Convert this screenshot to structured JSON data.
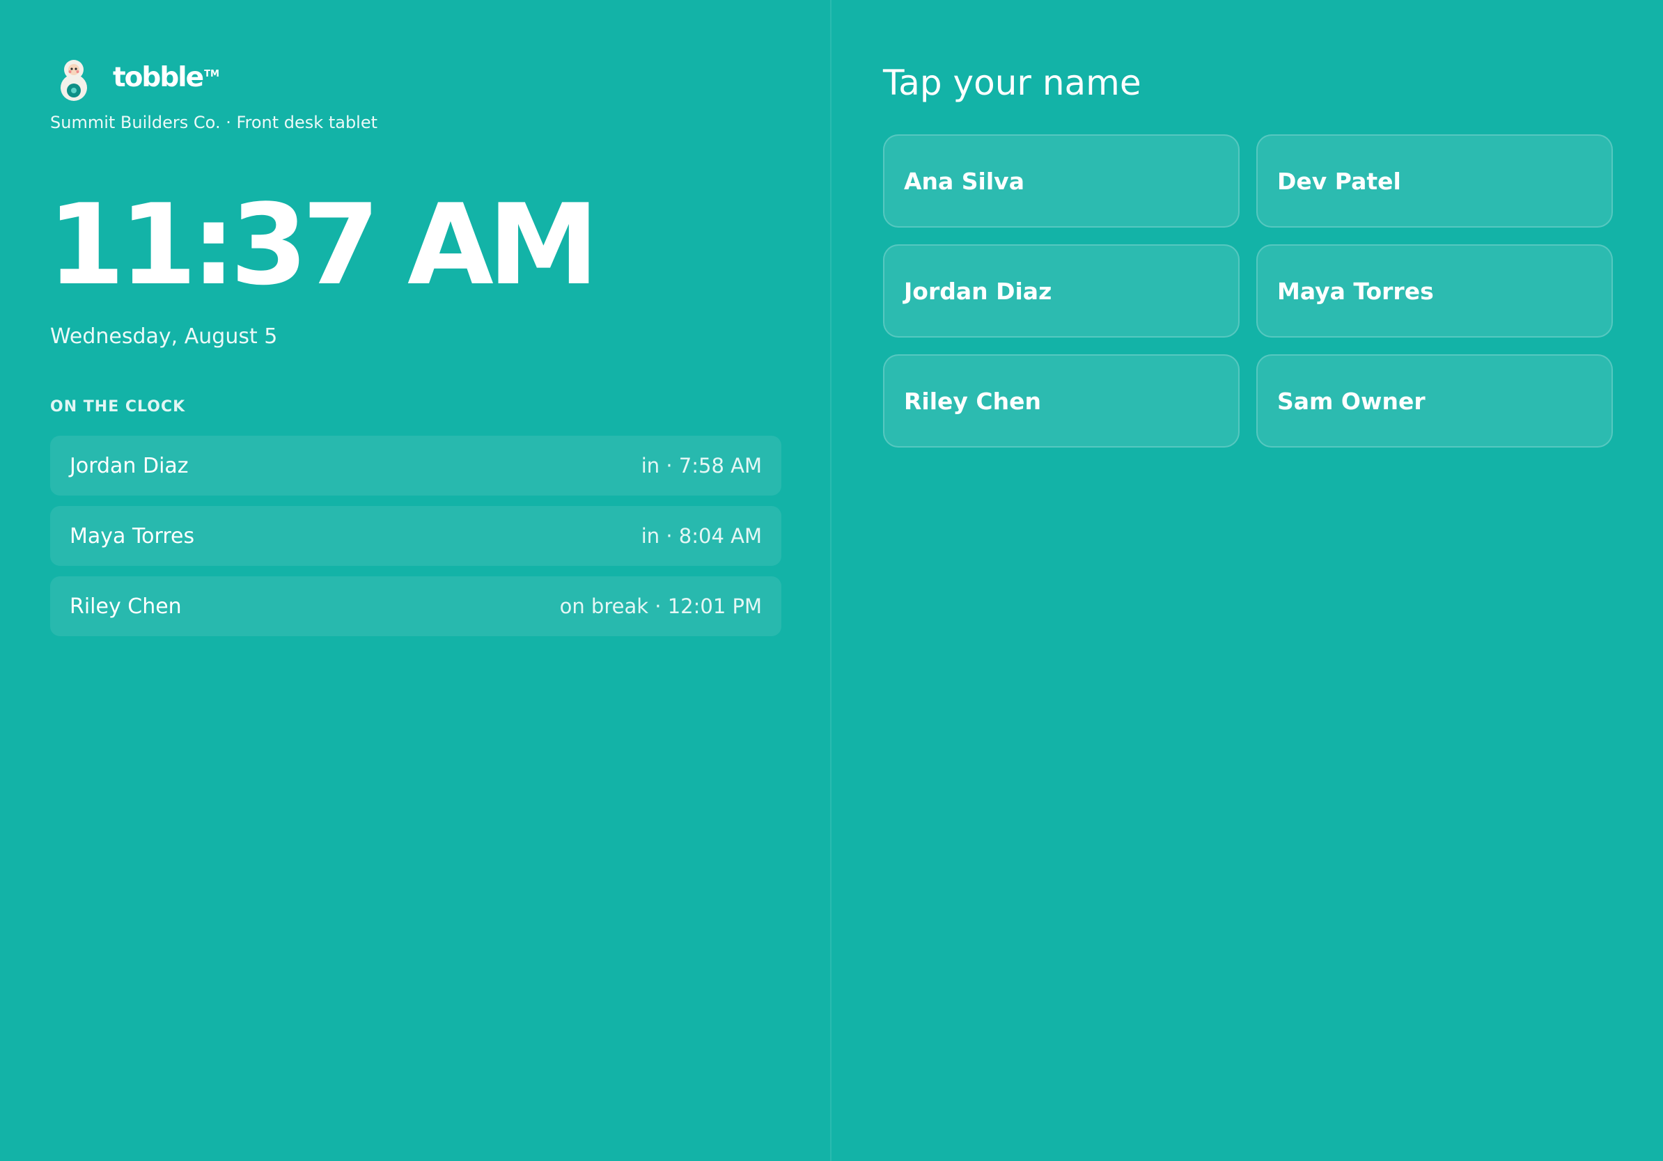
{
  "brand": {
    "name": "tobble",
    "trademark": "TM",
    "icon": "matryoshka-mascot-icon"
  },
  "header": {
    "org_line": "Summit Builders Co. · Front desk tablet"
  },
  "clock": {
    "time": "11:37 AM",
    "date": "Wednesday, August 5"
  },
  "on_the_clock": {
    "label": "ON THE CLOCK",
    "rows": [
      {
        "name": "Jordan Diaz",
        "status": "in · 7:58 AM"
      },
      {
        "name": "Maya Torres",
        "status": "in · 8:04 AM"
      },
      {
        "name": "Riley Chen",
        "status": "on break · 12:01 PM"
      }
    ]
  },
  "roster": {
    "title": "Tap your name",
    "people": [
      "Ana Silva",
      "Dev Patel",
      "Jordan Diaz",
      "Maya Torres",
      "Riley Chen",
      "Sam Owner"
    ]
  },
  "colors": {
    "background": "#13b3a7",
    "text": "#ffffff",
    "mascot_body": "#f3f1ea",
    "mascot_accent": "#0e8f86"
  }
}
